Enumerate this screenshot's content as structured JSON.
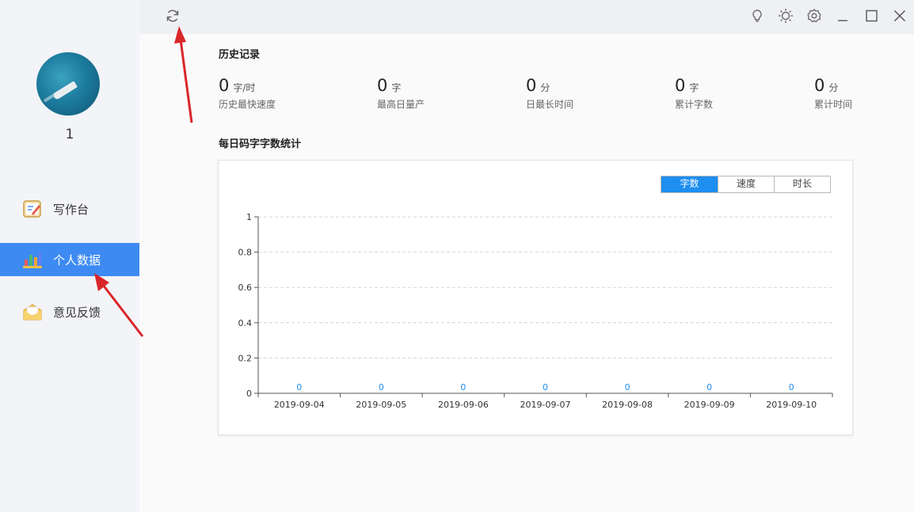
{
  "sidebar": {
    "username": "1",
    "items": [
      {
        "label": "写作台",
        "icon": "writing-board-icon",
        "active": false
      },
      {
        "label": "个人数据",
        "icon": "bar-chart-icon",
        "active": true
      },
      {
        "label": "意见反馈",
        "icon": "feedback-envelope-icon",
        "active": false
      }
    ]
  },
  "topbar": {
    "icons": [
      "refresh-icon",
      "lightbulb-icon",
      "brightness-icon",
      "settings-icon",
      "minimize-icon",
      "maximize-icon",
      "close-icon"
    ]
  },
  "history": {
    "title": "历史记录",
    "stats": [
      {
        "value": "0",
        "unit": "字/时",
        "label": "历史最快速度"
      },
      {
        "value": "0",
        "unit": "字",
        "label": "最高日量产"
      },
      {
        "value": "0",
        "unit": "分",
        "label": "日最长时间"
      },
      {
        "value": "0",
        "unit": "字",
        "label": "累计字数"
      },
      {
        "value": "0",
        "unit": "分",
        "label": "累计时间"
      }
    ]
  },
  "daily": {
    "title": "每日码字字数统计",
    "tabs": [
      {
        "label": "字数",
        "active": true
      },
      {
        "label": "速度",
        "active": false
      },
      {
        "label": "时长",
        "active": false
      }
    ]
  },
  "colors": {
    "accent": "#3d8bf2",
    "tab_active": "#1e8ef0",
    "data_label": "#1e8ef0",
    "arrow": "#d9262a"
  },
  "chart_data": {
    "type": "bar",
    "categories": [
      "2019-09-04",
      "2019-09-05",
      "2019-09-06",
      "2019-09-07",
      "2019-09-08",
      "2019-09-09",
      "2019-09-10"
    ],
    "values": [
      0,
      0,
      0,
      0,
      0,
      0,
      0
    ],
    "ylim": [
      0,
      1
    ],
    "yticks": [
      "0",
      "0.2",
      "0.4",
      "0.6",
      "0.8",
      "1"
    ],
    "ytick_values": [
      0,
      0.2,
      0.4,
      0.6,
      0.8,
      1
    ],
    "grid": true,
    "title": "",
    "xlabel": "",
    "ylabel": ""
  }
}
